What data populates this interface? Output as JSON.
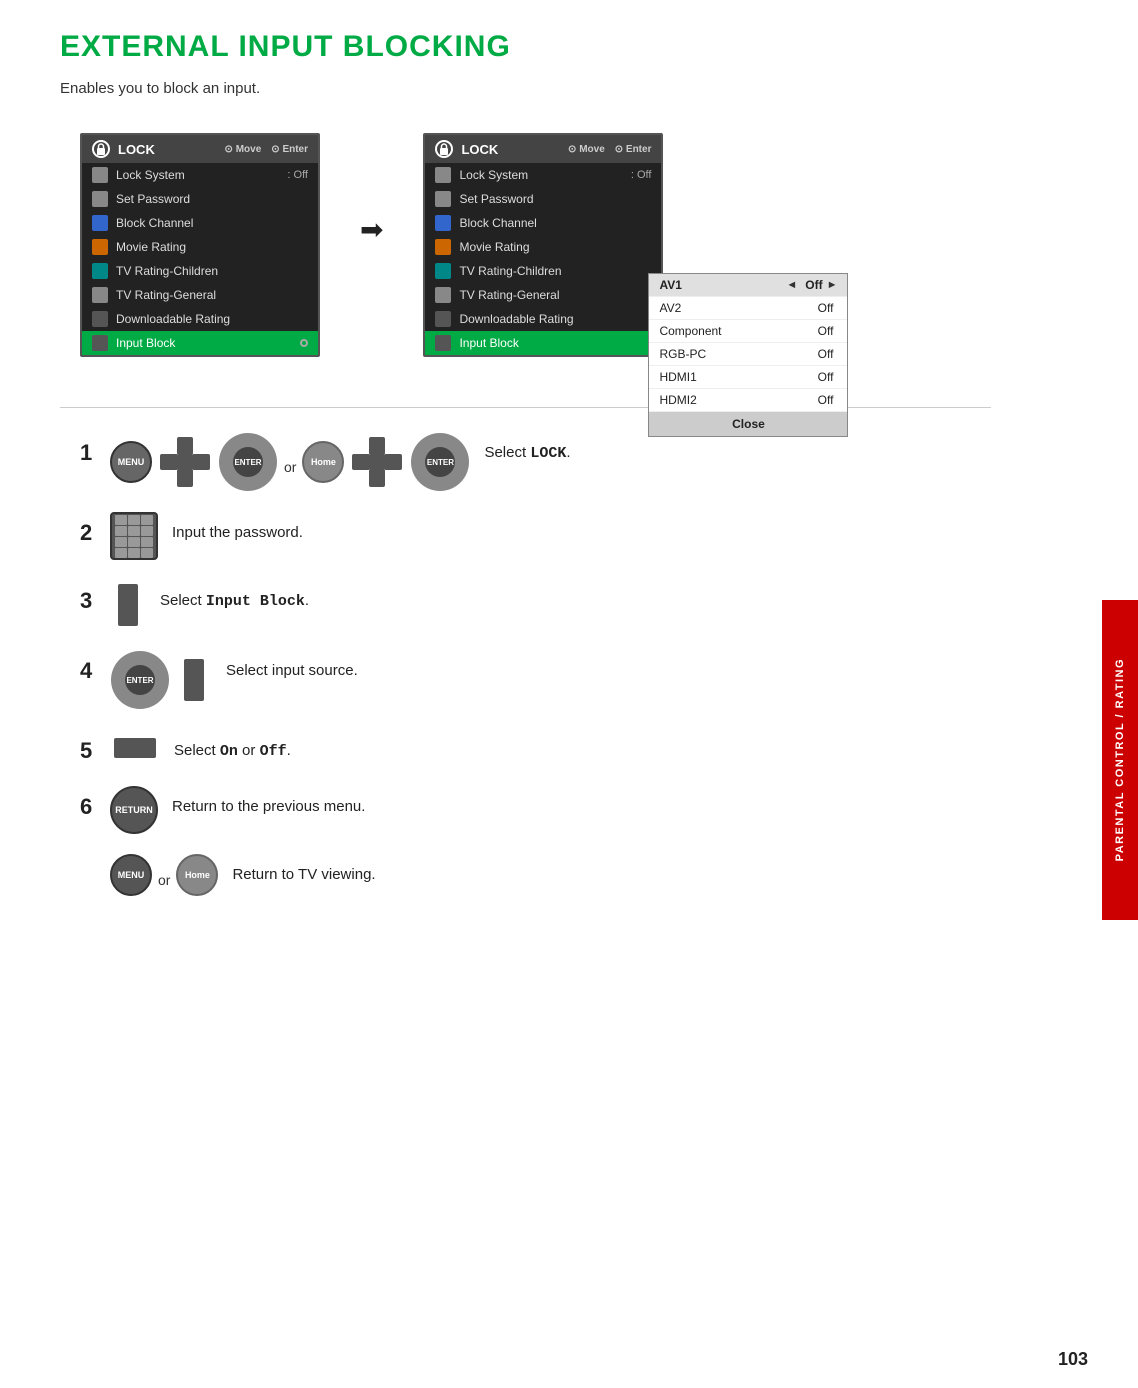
{
  "page": {
    "title": "EXTERNAL INPUT BLOCKING",
    "subtitle": "Enables you to block an input.",
    "page_number": "103",
    "sidebar_label": "PARENTAL CONTROL / RATING"
  },
  "menu_left": {
    "header": {
      "icon": "lock",
      "title": "LOCK",
      "nav_move": "Move",
      "nav_enter": "Enter"
    },
    "items": [
      {
        "label": "Lock System",
        "value": ": Off",
        "icon_color": "gray"
      },
      {
        "label": "Set Password",
        "value": "",
        "icon_color": "gray"
      },
      {
        "label": "Block Channel",
        "value": "",
        "icon_color": "blue"
      },
      {
        "label": "Movie Rating",
        "value": "",
        "icon_color": "orange"
      },
      {
        "label": "TV Rating-Children",
        "value": "",
        "icon_color": "teal"
      },
      {
        "label": "TV Rating-General",
        "value": "",
        "icon_color": "gray"
      },
      {
        "label": "Downloadable Rating",
        "value": "",
        "icon_color": "gray"
      },
      {
        "label": "Input Block",
        "value": "",
        "icon_color": "dark",
        "active": true
      }
    ]
  },
  "menu_right": {
    "header": {
      "icon": "lock",
      "title": "LOCK",
      "nav_move": "Move",
      "nav_enter": "Enter"
    },
    "items": [
      {
        "label": "Lock System",
        "value": ": Off",
        "icon_color": "gray"
      },
      {
        "label": "Set Password",
        "value": "",
        "icon_color": "gray"
      },
      {
        "label": "Block Channel",
        "value": "",
        "icon_color": "blue"
      },
      {
        "label": "Movie Rating",
        "value": "",
        "icon_color": "orange"
      },
      {
        "label": "TV Rating-Children",
        "value": "",
        "icon_color": "teal"
      },
      {
        "label": "TV Rating-General",
        "value": "",
        "icon_color": "gray"
      },
      {
        "label": "Downloadable Rating",
        "value": "",
        "icon_color": "gray"
      },
      {
        "label": "Input Block",
        "value": "",
        "icon_color": "dark",
        "active": true
      }
    ]
  },
  "sub_popup": {
    "rows": [
      {
        "label": "AV1",
        "value": "Off",
        "has_arrows": true
      },
      {
        "label": "AV2",
        "value": "Off",
        "has_arrows": false
      },
      {
        "label": "Component",
        "value": "Off",
        "has_arrows": false
      },
      {
        "label": "RGB-PC",
        "value": "Off",
        "has_arrows": false
      },
      {
        "label": "HDMI1",
        "value": "Off",
        "has_arrows": false
      },
      {
        "label": "HDMI2",
        "value": "Off",
        "has_arrows": false
      }
    ],
    "close_label": "Close"
  },
  "steps": [
    {
      "number": "1",
      "buttons": [
        "MENU",
        "dpad",
        "ENTER",
        "or",
        "Home",
        "dpad",
        "ENTER"
      ],
      "text": "Select ",
      "bold_text": "LOCK",
      "text_suffix": "."
    },
    {
      "number": "2",
      "buttons": [
        "numpad"
      ],
      "text": "Input the password."
    },
    {
      "number": "3",
      "buttons": [
        "updown"
      ],
      "text": "Select ",
      "bold_text": "Input Block",
      "text_suffix": "."
    },
    {
      "number": "4",
      "buttons": [
        "ENTER",
        "updown"
      ],
      "text": "Select input source."
    },
    {
      "number": "5",
      "buttons": [
        "leftright"
      ],
      "text": "Select ",
      "bold_text": "On",
      "text_middle": " or ",
      "bold_text2": "Off",
      "text_suffix": "."
    },
    {
      "number": "6",
      "buttons": [
        "RETURN"
      ],
      "text": "Return to the previous menu."
    },
    {
      "number": "",
      "buttons": [
        "MENU",
        "or",
        "Home"
      ],
      "text": "Return to TV viewing."
    }
  ]
}
